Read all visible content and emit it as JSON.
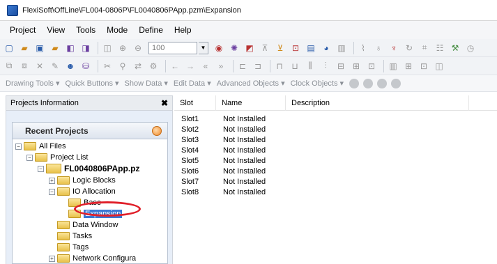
{
  "window": {
    "title": "FlexiSoft\\OffLine\\FL004-0806P\\FL0040806PApp.pzm\\Expansion"
  },
  "menu": [
    "Project",
    "View",
    "Tools",
    "Mode",
    "Define",
    "Help"
  ],
  "toolbar": {
    "zoom_value": "100",
    "secondary_items": [
      "Drawing Tools ▾",
      "Quick Buttons ▾",
      "Show Data ▾",
      "Edit Data ▾",
      "Advanced Objects ▾",
      "Clock Objects ▾"
    ]
  },
  "sidebar": {
    "title": "Projects Information",
    "close_label": "✖",
    "recent_title": "Recent Projects",
    "tree": [
      {
        "label": "All Files",
        "level": 0,
        "expander": "−"
      },
      {
        "label": "Project List",
        "level": 1,
        "expander": "−"
      },
      {
        "label": "FL0040806PApp.pz",
        "level": 2,
        "expander": "−",
        "bold": true
      },
      {
        "label": "Logic Blocks",
        "level": 3,
        "expander": "+"
      },
      {
        "label": "IO Allocation",
        "level": 3,
        "expander": "−"
      },
      {
        "label": "Base",
        "level": 4,
        "expander": ""
      },
      {
        "label": "Expansion",
        "level": 4,
        "expander": "",
        "selected": true
      },
      {
        "label": "Data Window",
        "level": 3,
        "expander": ""
      },
      {
        "label": "Tasks",
        "level": 3,
        "expander": ""
      },
      {
        "label": "Tags",
        "level": 3,
        "expander": ""
      },
      {
        "label": "Network Configura",
        "level": 3,
        "expander": "+"
      }
    ]
  },
  "table": {
    "columns": [
      "Slot",
      "Name",
      "Description"
    ],
    "rows": [
      {
        "slot": "Slot1",
        "name": "Not Installed",
        "description": ""
      },
      {
        "slot": "Slot2",
        "name": "Not Installed",
        "description": ""
      },
      {
        "slot": "Slot3",
        "name": "Not Installed",
        "description": ""
      },
      {
        "slot": "Slot4",
        "name": "Not Installed",
        "description": ""
      },
      {
        "slot": "Slot5",
        "name": "Not Installed",
        "description": ""
      },
      {
        "slot": "Slot6",
        "name": "Not Installed",
        "description": ""
      },
      {
        "slot": "Slot7",
        "name": "Not Installed",
        "description": ""
      },
      {
        "slot": "Slot8",
        "name": "Not Installed",
        "description": ""
      }
    ]
  },
  "colors": {
    "selection": "#3a78d4",
    "highlight_ring": "#e0202a",
    "panel_bg": "#e7eef8"
  }
}
